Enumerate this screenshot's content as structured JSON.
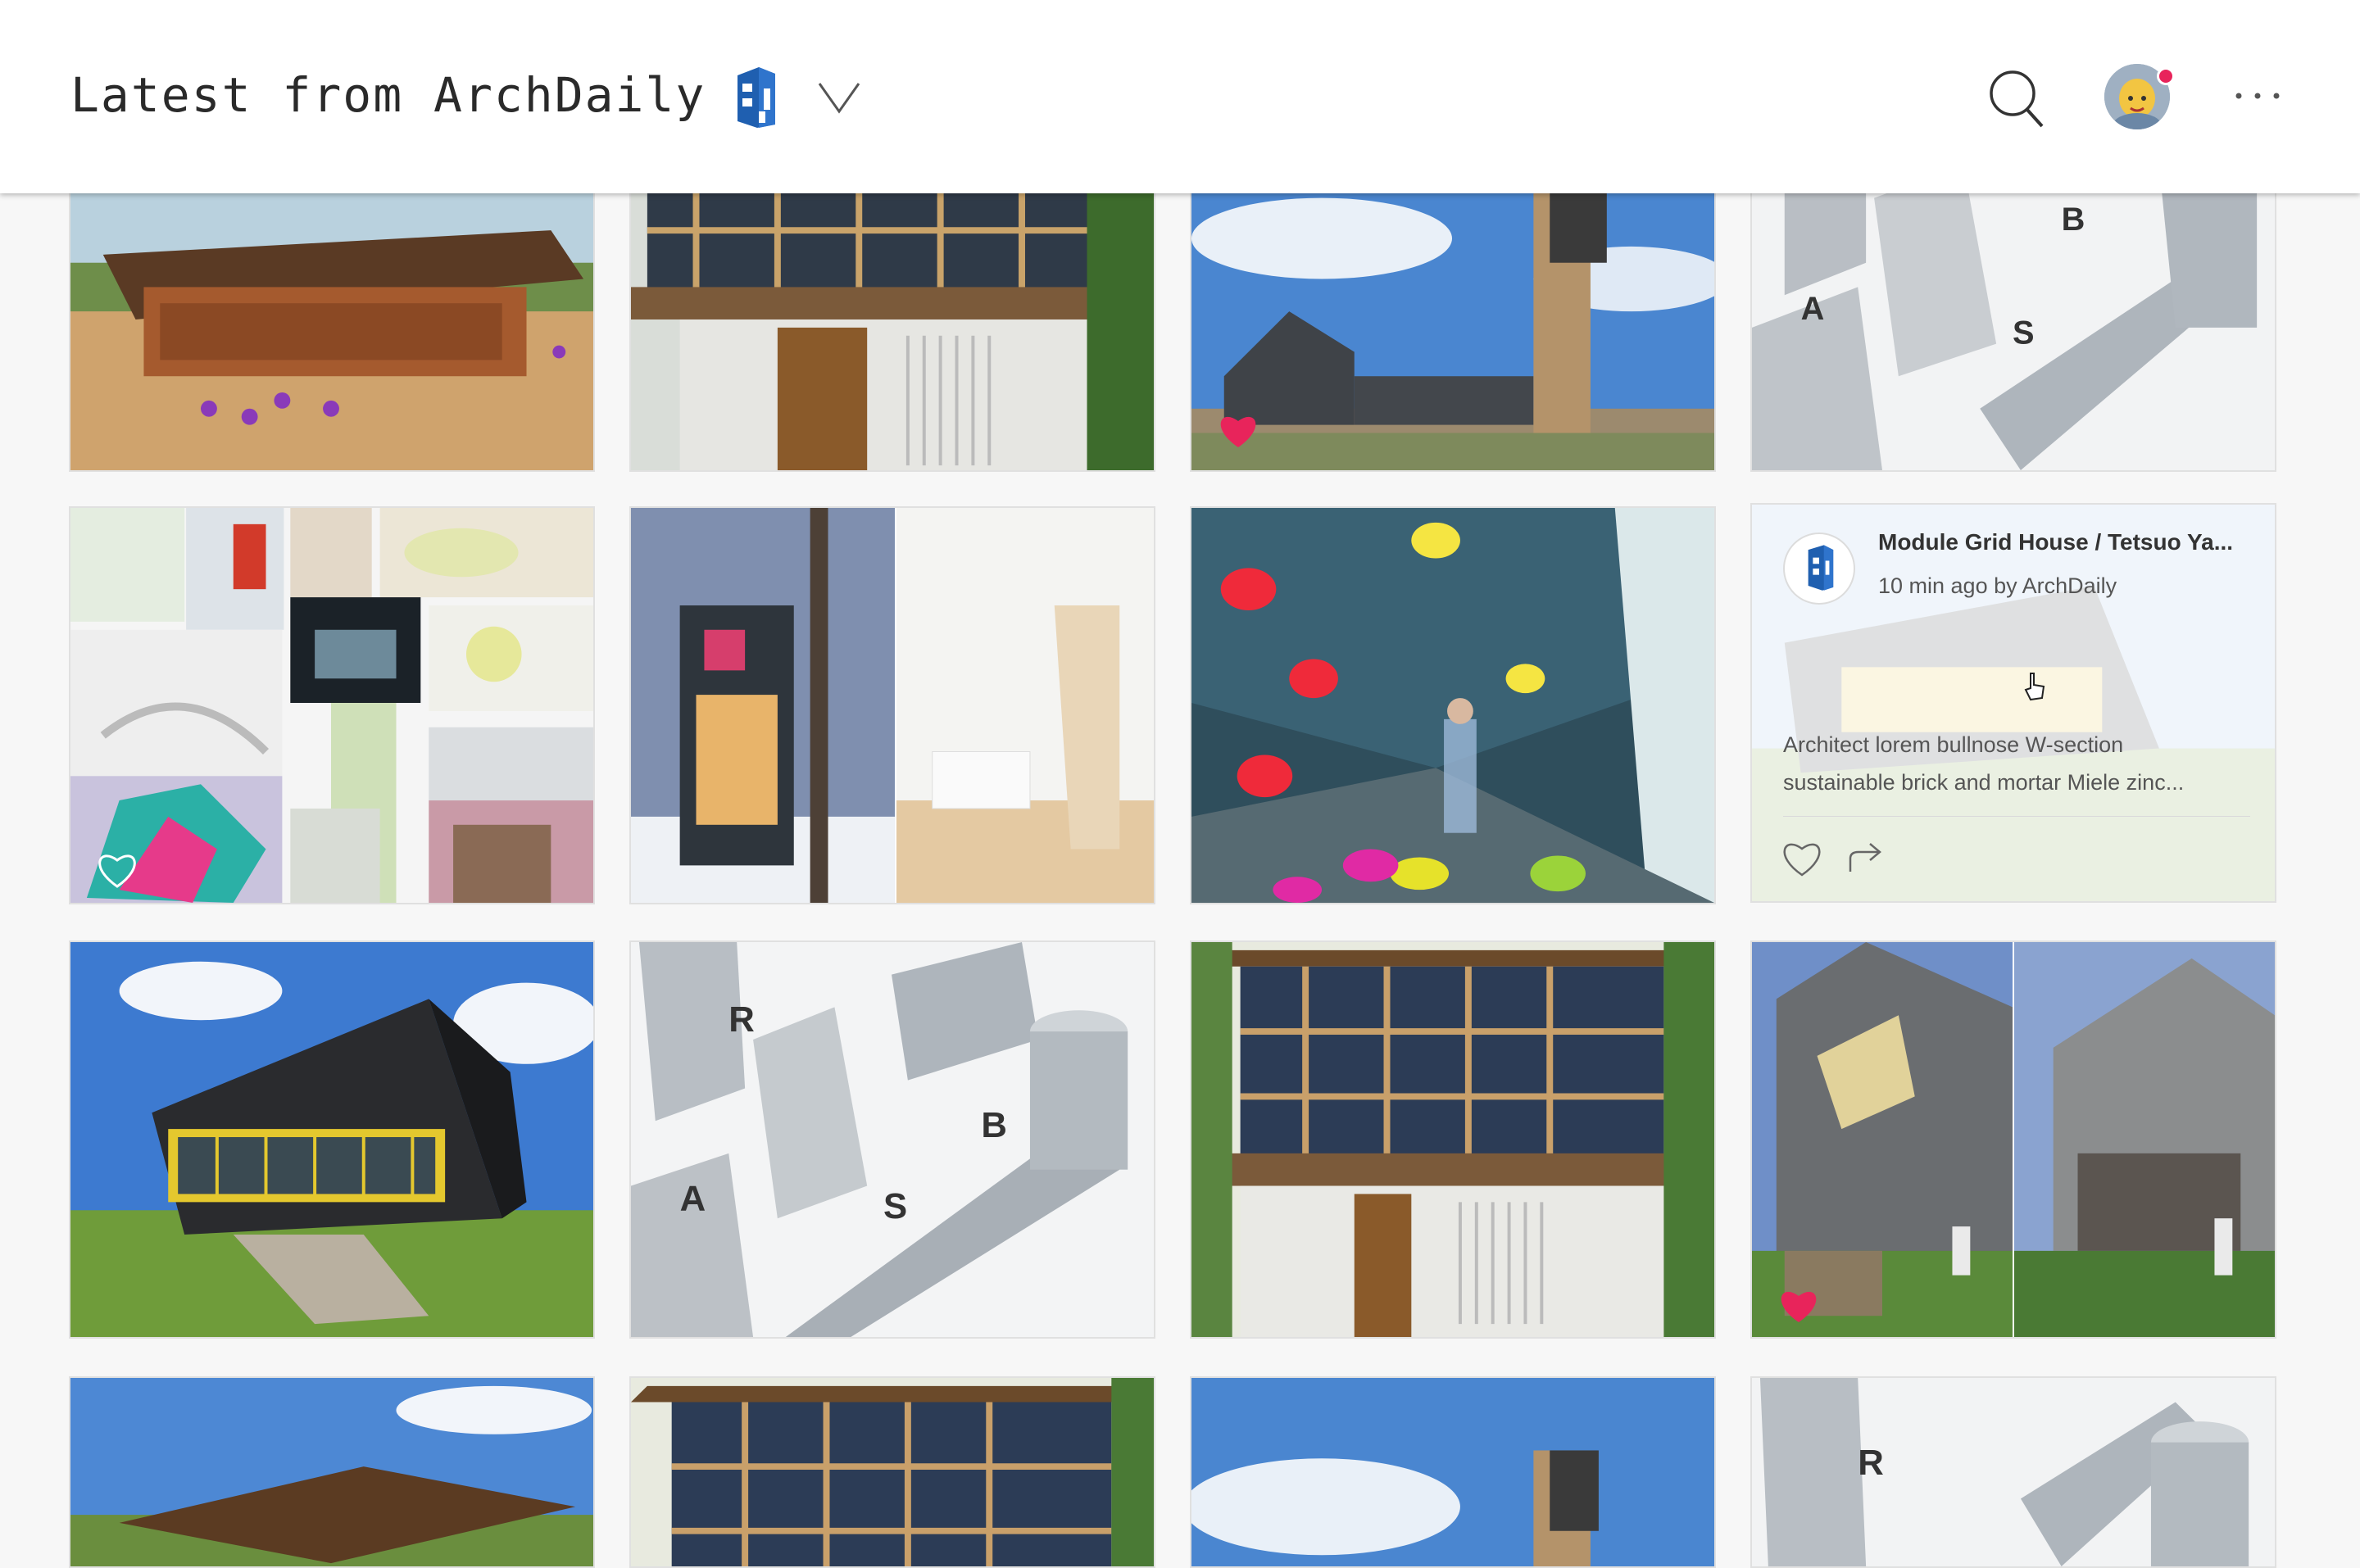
{
  "header": {
    "title": "Latest from ArchDaily",
    "brand_icon": "archdaily-building-logo-icon",
    "dropdown_icon": "chevron-down-icon",
    "search_icon": "search-icon",
    "avatar_icon": "user-avatar",
    "notification_color": "#e8245b",
    "more_icon": "more-horizontal-icon"
  },
  "feed": {
    "tiles": [
      {
        "name": "school-brick-building",
        "liked": false
      },
      {
        "name": "module-grid-house-facade",
        "liked": false
      },
      {
        "name": "tower-house-blue-sky",
        "liked": true
      },
      {
        "name": "city-model-letters",
        "liked": false
      },
      {
        "name": "collage-architecture-models",
        "liked": false
      },
      {
        "name": "winter-house-interior-split",
        "liked": false
      },
      {
        "name": "climbing-wall-interior",
        "liked": false
      },
      {
        "name": "module-grid-house-card",
        "liked": false
      },
      {
        "name": "black-angled-building",
        "liked": false
      },
      {
        "name": "city-model-letters",
        "liked": false
      },
      {
        "name": "module-grid-house-facade",
        "liked": false
      },
      {
        "name": "grey-brick-house-split",
        "liked": true
      },
      {
        "name": "school-brick-building",
        "liked": false
      },
      {
        "name": "module-grid-house-facade",
        "liked": false
      },
      {
        "name": "tower-house-blue-sky",
        "liked": false
      },
      {
        "name": "city-model-letters",
        "liked": false
      }
    ],
    "hover_card": {
      "title": "Module Grid House / Tetsuo Ya...",
      "meta": "10 min ago by ArchDaily",
      "description": "Architect lorem bullnose W-section sustainable brick and mortar Miele zinc...",
      "like_icon": "heart-outline-icon",
      "share_icon": "share-arrow-icon"
    },
    "like_color": "#e8245b"
  }
}
